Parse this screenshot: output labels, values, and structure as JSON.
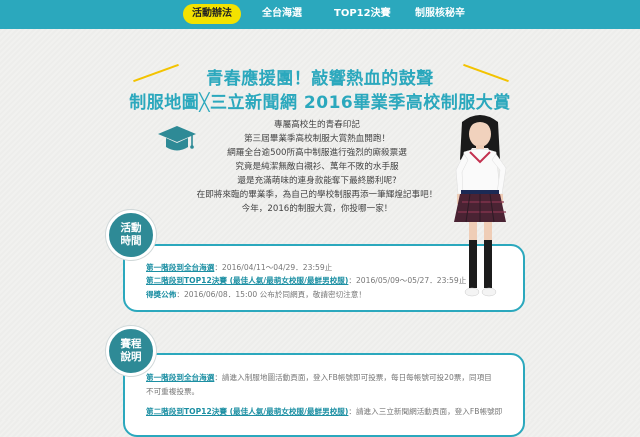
{
  "nav": {
    "items": [
      {
        "label": "活動辦法",
        "active": true
      },
      {
        "label": "全台海選",
        "active": false
      },
      {
        "label": "TOP12決賽",
        "active": false
      },
      {
        "label": "制服核秘辛",
        "active": false
      }
    ],
    "bar_color": "#2ba8bd",
    "active_color": "#f3e200"
  },
  "header": {
    "line1": "青春應援團！敲響熱血的鼓聲",
    "line2": "制服地圖╳三立新聞網 2016畢業季高校制服大賞"
  },
  "intro": [
    "專屬高校生的青春印記",
    "第三屆畢業季高校制服大賞熱血開跑！",
    "網羅全台逾500所高中制服進行強烈的廝殺票選",
    "究竟是純潔無敵白襯衫、萬年不敗的水手服",
    "還是充滿萌味的連身款能奪下最終勝利呢?",
    "在即將來臨的畢業季，為自己的學校制服再添一筆輝煌記事吧！",
    "今年，2016的制服大賞，你投哪一家！"
  ],
  "schedule": {
    "badge": "活動\n時間",
    "rows": [
      {
        "label": "第一階段到全台海選",
        "text": "：2016/04/11～04/29．23:59止"
      },
      {
        "label": "第二階段到TOP12決賽 (最佳人氣/最萌女校服/最鮮男校服)",
        "text": "：2016/05/09～05/27．23:59止"
      },
      {
        "label": "得獎公佈",
        "text": "：2016/06/08．15:00 公布於同網頁，敬請密切注意！"
      }
    ]
  },
  "rules": {
    "badge": "賽程\n說明",
    "rows": [
      {
        "label": "第一階段到全台海選",
        "text": "：請進入制服地圖活動頁面，登入FB帳號即可投票，每日每帳號可投20票，同項目"
      },
      {
        "label": "",
        "text": "不可重複投票。"
      },
      {
        "label": "第二階段到TOP12決賽 (最佳人氣/最萌女校服/最鮮男校服)",
        "text": "：請進入三立新聞網活動頁面，登入FB帳號即"
      }
    ]
  },
  "icons": {
    "graduation": "graduation-cap-icon"
  }
}
